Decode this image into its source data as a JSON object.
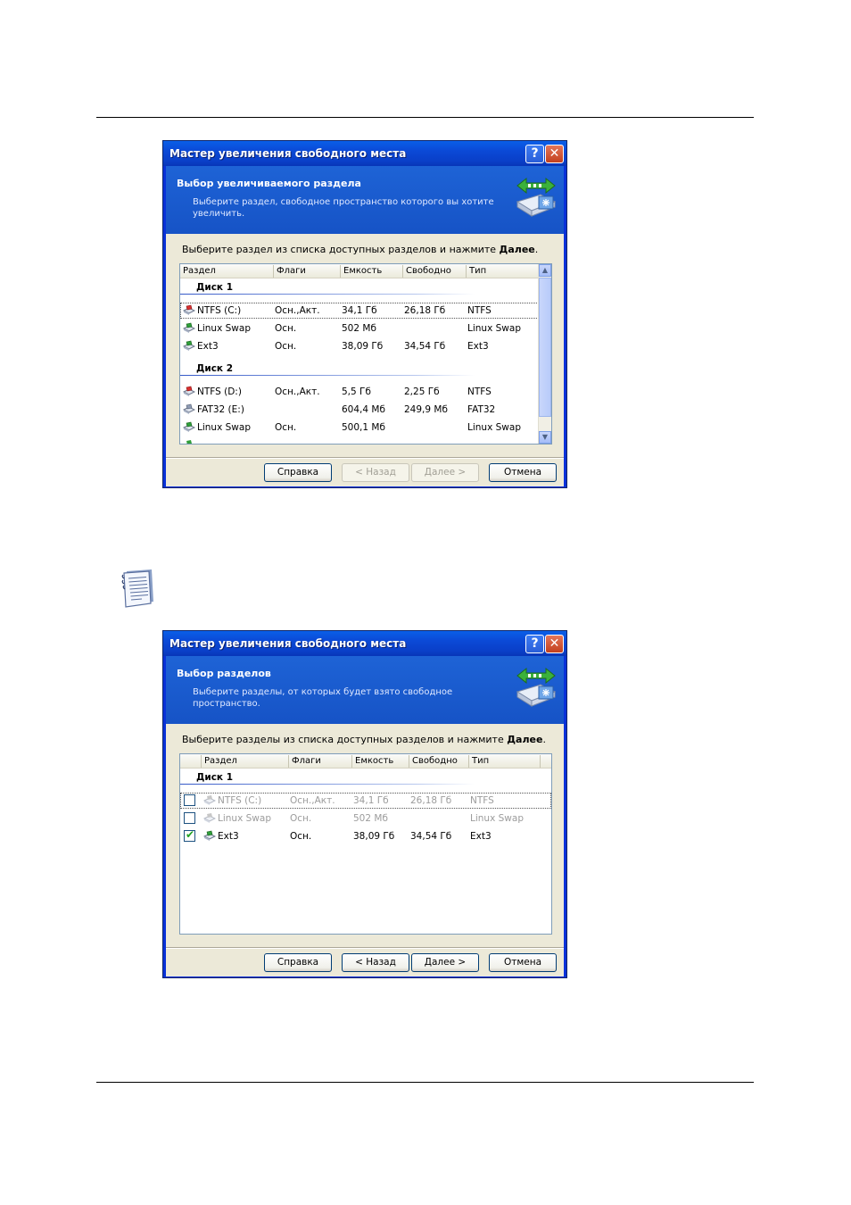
{
  "dialog1": {
    "title": "Мастер увеличения свободного места",
    "help_glyph": "?",
    "close_glyph": "✕",
    "header_title": "Выбор увеличиваемого раздела",
    "header_desc": "Выберите раздел, свободное пространство которого вы хотите увеличить.",
    "instruction_prefix": "Выберите раздел из списка доступных разделов и нажмите ",
    "instruction_bold": "Далее",
    "instruction_suffix": ".",
    "columns": [
      "Раздел",
      "Флаги",
      "Емкость",
      "Свободно",
      "Тип"
    ],
    "groups": [
      "Диск 1",
      "Диск 2"
    ],
    "rows": [
      {
        "name": "NTFS (C:)",
        "flags": "Осн.,Акт.",
        "capacity": "34,1 Гб",
        "free": "26,18 Гб",
        "type": "NTFS",
        "icon": "ntfs-partition-icon"
      },
      {
        "name": "Linux Swap",
        "flags": "Осн.",
        "capacity": "502 Мб",
        "free": "",
        "type": "Linux Swap",
        "icon": "linux-partition-icon"
      },
      {
        "name": "Ext3",
        "flags": "Осн.",
        "capacity": "38,09 Гб",
        "free": "34,54 Гб",
        "type": "Ext3",
        "icon": "linux-partition-icon"
      },
      {
        "name": "NTFS (D:)",
        "flags": "Осн.,Акт.",
        "capacity": "5,5 Гб",
        "free": "2,25 Гб",
        "type": "NTFS",
        "icon": "ntfs-partition-icon"
      },
      {
        "name": "FAT32 (E:)",
        "flags": "",
        "capacity": "604,4 Мб",
        "free": "249,9 Мб",
        "type": "FAT32",
        "icon": "fat-partition-icon"
      },
      {
        "name": "Linux Swap",
        "flags": "Осн.",
        "capacity": "500,1 Мб",
        "free": "",
        "type": "Linux Swap",
        "icon": "linux-partition-icon"
      }
    ],
    "buttons": {
      "help": "Справка",
      "back": "< Назад",
      "next": "Далее >",
      "cancel": "Отмена"
    }
  },
  "dialog2": {
    "title": "Мастер увеличения свободного места",
    "help_glyph": "?",
    "close_glyph": "✕",
    "header_title": "Выбор разделов",
    "header_desc": "Выберите разделы, от которых будет взято свободное пространство.",
    "instruction_prefix": "Выберите разделы из списка доступных разделов и нажмите ",
    "instruction_bold": "Далее",
    "instruction_suffix": ".",
    "columns": [
      "Раздел",
      "Флаги",
      "Емкость",
      "Свободно",
      "Тип"
    ],
    "groups": [
      "Диск 1"
    ],
    "rows": [
      {
        "name": "NTFS (C:)",
        "flags": "Осн.,Акт.",
        "capacity": "34,1 Гб",
        "free": "26,18 Гб",
        "type": "NTFS",
        "checked": false,
        "enabled": false
      },
      {
        "name": "Linux Swap",
        "flags": "Осн.",
        "capacity": "502 Мб",
        "free": "",
        "type": "Linux Swap",
        "checked": false,
        "enabled": false
      },
      {
        "name": "Ext3",
        "flags": "Осн.",
        "capacity": "38,09 Гб",
        "free": "34,54 Гб",
        "type": "Ext3",
        "checked": true,
        "enabled": true
      }
    ],
    "buttons": {
      "help": "Справка",
      "back": "< Назад",
      "next": "Далее >",
      "cancel": "Отмена"
    }
  },
  "colors": {
    "xp_title_blue": "#0a5fe8",
    "header_blue": "#1e63d6",
    "dialog_face": "#ece9d8",
    "close_red": "#c3401d",
    "check_green": "#21a121"
  }
}
